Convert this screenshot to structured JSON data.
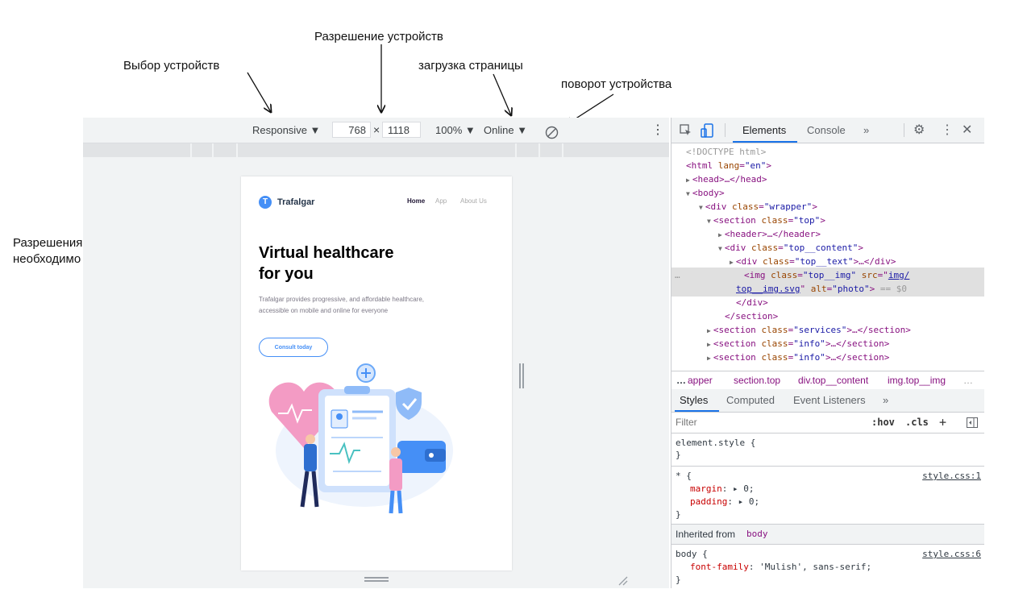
{
  "annotations": {
    "device_resolution": "Разрешение устройств",
    "device_select": "Выбор устройств",
    "page_loading": "загрузка страницы",
    "device_rotation": "поворот устройства",
    "resolutions_to_check": "Разрешения которые\nнеобходимо проверить"
  },
  "device_toolbar": {
    "device": "Responsive ▼",
    "width": "768",
    "times": "×",
    "height": "1118",
    "zoom": "100% ▼",
    "throttling": "Online ▼",
    "more_icon": "⋮"
  },
  "page": {
    "logo_letter": "T",
    "brand": "Trafalgar",
    "nav": [
      "Home",
      "App",
      "About Us"
    ],
    "headline": "Virtual healthcare\nfor you",
    "lead": "Trafalgar provides progressive, and affordable healthcare, accessible on mobile and online for everyone",
    "cta": "Consult today"
  },
  "devtools": {
    "tabs": [
      "Elements",
      "Console",
      "»"
    ],
    "dom_lines": {
      "doctype": "<!DOCTYPE html>",
      "html_tag": "<html",
      "html_attr": "lang",
      "html_val": "\"en\"",
      "head": "<head>…</head>",
      "body": "<body>",
      "wrapper_attr": "class",
      "wrapper_val": "\"wrapper\"",
      "section_top_val": "\"top\"",
      "header": "<header>…</header>",
      "top_content_val": "\"top__content\"",
      "top_text_val": "\"top__text\"",
      "img_class_val": "\"top__img\"",
      "img_src_attr": "src",
      "img_src_val_1": "img/",
      "img_src_val_2": "top__img.svg",
      "img_alt_attr": "alt",
      "img_alt_val": "\"photo\"",
      "selected_marker": "== $0",
      "close_div": "</div>",
      "close_section": "</section>",
      "services_val": "\"services\"",
      "info_val": "\"info\"",
      "ellipsis_gutter": "…"
    },
    "breadcrumbs": [
      "…",
      "apper",
      "section.top",
      "div.top__content",
      "img.top__img",
      "…"
    ],
    "style_tabs": [
      "Styles",
      "Computed",
      "Event Listeners",
      "»"
    ],
    "filter_placeholder": "Filter",
    "filter_options": [
      ":hov",
      ".cls",
      "+"
    ],
    "rules": {
      "element_style": "element.style {",
      "close": "}",
      "star_selector": "* {",
      "star_source": "style.css:1",
      "margin_prop": "margin",
      "margin_val": ": ▸ 0;",
      "padding_prop": "padding",
      "padding_val": ": ▸ 0;",
      "inherited_label": "Inherited from",
      "inherited_tag": "body",
      "body_selector": "body {",
      "body_source": "style.css:6",
      "font_prop": "font-family",
      "font_val": ": 'Mulish', sans-serif;"
    }
  }
}
